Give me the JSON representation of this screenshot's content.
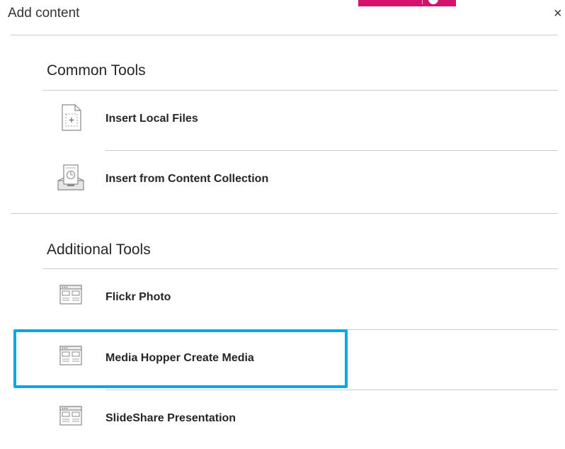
{
  "panel": {
    "title": "Add content",
    "close_symbol": "×"
  },
  "sections": [
    {
      "heading": "Common Tools",
      "items": [
        {
          "label": "Insert Local Files",
          "icon": "file-upload-icon"
        },
        {
          "label": "Insert from Content Collection",
          "icon": "content-collection-icon"
        }
      ]
    },
    {
      "heading": "Additional Tools",
      "items": [
        {
          "label": "Flickr Photo",
          "icon": "web-tool-icon"
        },
        {
          "label": "Media Hopper Create Media",
          "icon": "web-tool-icon",
          "highlighted": true
        },
        {
          "label": "SlideShare Presentation",
          "icon": "web-tool-icon"
        }
      ]
    }
  ],
  "colors": {
    "brand_badge": "#d3136b",
    "highlight": "#00a8e8",
    "divider": "#cdcdcd",
    "text": "#262626"
  }
}
